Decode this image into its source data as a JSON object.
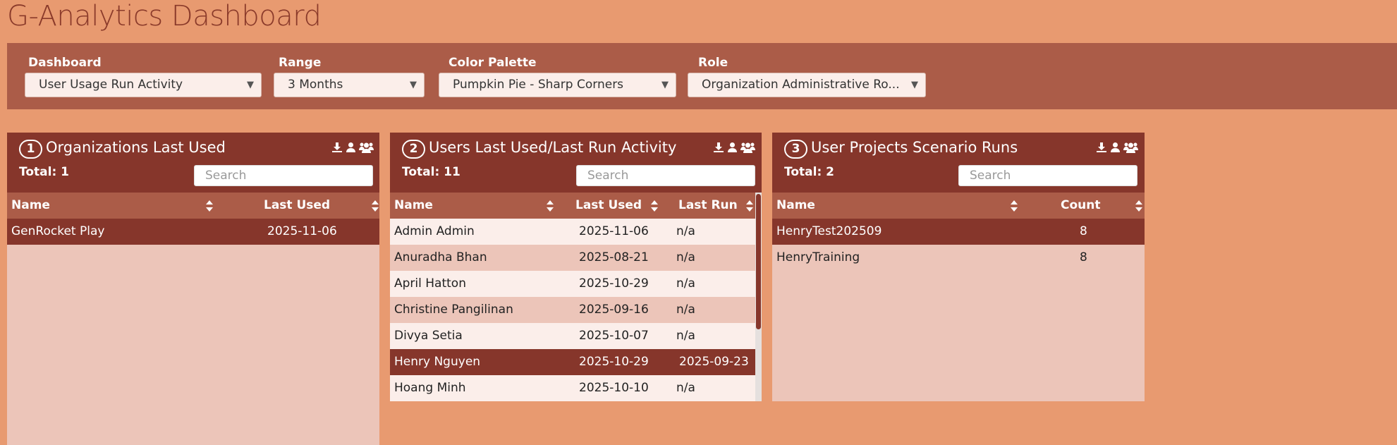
{
  "page": {
    "title": "G-Analytics Dashboard"
  },
  "filters": {
    "dashboard": {
      "label": "Dashboard",
      "value": "User Usage Run Activity"
    },
    "range": {
      "label": "Range",
      "value": "3 Months"
    },
    "palette": {
      "label": "Color Palette",
      "value": "Pumpkin Pie - Sharp Corners"
    },
    "role": {
      "label": "Role",
      "value": "Organization Administrative Ro..."
    }
  },
  "panels": {
    "orgs": {
      "num": "1",
      "title": "Organizations Last Used",
      "total": "Total: 1",
      "search_placeholder": "Search",
      "columns": [
        "Name",
        "Last Used"
      ],
      "rows": [
        [
          "GenRocket Play",
          "2025-11-06"
        ]
      ]
    },
    "users": {
      "num": "2",
      "title": "Users Last Used/Last Run Activity",
      "total": "Total: 11",
      "search_placeholder": "Search",
      "columns": [
        "Name",
        "Last Used",
        "Last Run"
      ],
      "rows": [
        [
          "Admin Admin",
          "2025-11-06",
          "n/a"
        ],
        [
          "Anuradha Bhan",
          "2025-08-21",
          "n/a"
        ],
        [
          "April Hatton",
          "2025-10-29",
          "n/a"
        ],
        [
          "Christine Pangilinan",
          "2025-09-16",
          "n/a"
        ],
        [
          "Divya Setia",
          "2025-10-07",
          "n/a"
        ],
        [
          "Henry Nguyen",
          "2025-10-29",
          "2025-09-23"
        ],
        [
          "Hoang Minh",
          "2025-10-10",
          "n/a"
        ]
      ]
    },
    "projects": {
      "num": "3",
      "title": "User Projects Scenario Runs",
      "total": "Total: 2",
      "search_placeholder": "Search",
      "columns": [
        "Name",
        "Count"
      ],
      "rows": [
        [
          "HenryTest202509",
          "8"
        ],
        [
          "HenryTraining",
          "8"
        ]
      ]
    }
  },
  "icons": [
    "download-icon",
    "user-icon",
    "users-group-icon",
    "sort-icon",
    "caret-down-icon"
  ],
  "colors": {
    "background": "#e89a70",
    "bar": "#ab5c48",
    "header": "#86362b",
    "row_light": "#fbeeea",
    "row_mid": "#ecc5b9",
    "title": "#8a3a2a"
  }
}
